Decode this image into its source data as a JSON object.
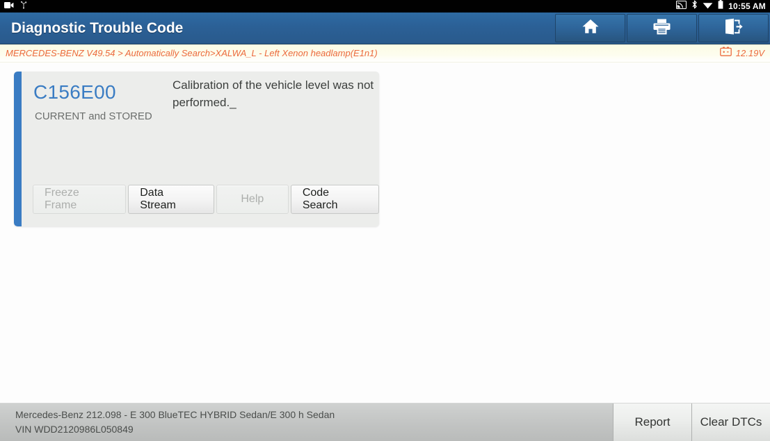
{
  "statusbar": {
    "left_icons": [
      "camcorder-icon",
      "usb-debug-icon"
    ],
    "right_icons": [
      "cast-icon",
      "bluetooth-icon",
      "wifi-icon",
      "battery-icon"
    ],
    "time": "10:55 AM"
  },
  "titlebar": {
    "title": "Diagnostic Trouble Code",
    "buttons": [
      {
        "name": "home-button",
        "icon": "home-icon"
      },
      {
        "name": "print-button",
        "icon": "printer-icon"
      },
      {
        "name": "exit-button",
        "icon": "exit-icon"
      }
    ]
  },
  "pathbar": {
    "breadcrumb": "MERCEDES-BENZ V49.54 > Automatically Search>XALWA_L - Left Xenon headlamp(E1n1)",
    "voltage": "12.19V",
    "voltage_icon": "battery-voltage-icon"
  },
  "dtc_card": {
    "code": "C156E00",
    "status": "CURRENT and STORED",
    "description": "Calibration of the vehicle level was not performed._",
    "accent_color": "#3a7cc3",
    "buttons": [
      {
        "label": "Freeze Frame",
        "enabled": false
      },
      {
        "label": "Data Stream",
        "enabled": true
      },
      {
        "label": "Help",
        "enabled": false
      },
      {
        "label": "Code Search",
        "enabled": true
      }
    ]
  },
  "bottombar": {
    "vehicle_line1": "Mercedes-Benz 212.098 - E 300 BlueTEC HYBRID Sedan/E 300 h Sedan",
    "vehicle_line2": "VIN WDD2120986L050849",
    "report_label": "Report",
    "clear_dtcs_label": "Clear DTCs"
  },
  "colors": {
    "title_blue": "#2b6096",
    "accent_blue": "#3a7cc3",
    "breadcrumb_orange": "#ec6a3e",
    "card_bg": "#ecedeb"
  }
}
